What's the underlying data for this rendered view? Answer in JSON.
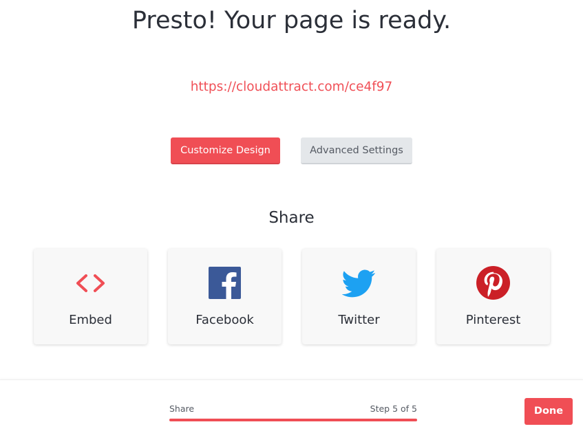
{
  "header": {
    "title": "Presto! Your page is ready.",
    "page_url": "https://cloudattract.com/ce4f97"
  },
  "actions": {
    "customize_label": "Customize Design",
    "advanced_label": "Advanced Settings"
  },
  "share": {
    "heading": "Share",
    "items": [
      {
        "label": "Embed",
        "icon": "code-brackets-icon"
      },
      {
        "label": "Facebook",
        "icon": "facebook-icon"
      },
      {
        "label": "Twitter",
        "icon": "twitter-icon"
      },
      {
        "label": "Pinterest",
        "icon": "pinterest-icon"
      }
    ]
  },
  "footer": {
    "step_name": "Share",
    "step_text": "Step 5 of 5",
    "progress_fraction": 1.0,
    "done_label": "Done"
  },
  "colors": {
    "accent": "#f04e55",
    "facebook": "#3b5998",
    "twitter": "#1da1f2",
    "pinterest": "#cb2027"
  }
}
